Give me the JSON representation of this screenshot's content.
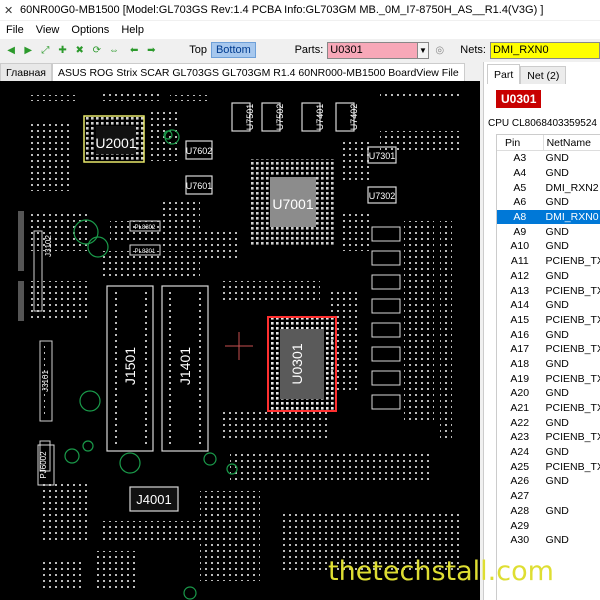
{
  "window": {
    "title": "60NR00G0-MB1500 [Model:GL703GS  Rev:1.4 PCBA Info:GL703GM MB._0M_I7-8750H_AS__R1.4(V3G) ]"
  },
  "menu": [
    "File",
    "View",
    "Options",
    "Help"
  ],
  "toolbar": {
    "top_label": "Top",
    "bottom_label": "Bottom",
    "parts_label": "Parts:",
    "parts_value": "U0301",
    "nets_label": "Nets:",
    "nets_value": "DMI_RXN0"
  },
  "tabs": {
    "main": "Главная",
    "file": "ASUS ROG Strix SCAR GL703GS GL703GM R1.4 60NR000-MB1500 BoardView File"
  },
  "right_panel": {
    "tab_part": "Part",
    "tab_net": "Net (2)",
    "part_name": "U0301",
    "part_desc": "CPU CL8068403359524",
    "col_pin": "Pin",
    "col_netname": "NetName",
    "pins": [
      {
        "pin": "A3",
        "net": "GND"
      },
      {
        "pin": "A4",
        "net": "GND"
      },
      {
        "pin": "A5",
        "net": "DMI_RXN2"
      },
      {
        "pin": "A6",
        "net": "GND"
      },
      {
        "pin": "A8",
        "net": "DMI_RXN0",
        "selected": true
      },
      {
        "pin": "A9",
        "net": "GND"
      },
      {
        "pin": "A10",
        "net": "GND"
      },
      {
        "pin": "A11",
        "net": "PCIENB_TXP"
      },
      {
        "pin": "A12",
        "net": "GND"
      },
      {
        "pin": "A13",
        "net": "PCIENB_TXP"
      },
      {
        "pin": "A14",
        "net": "GND"
      },
      {
        "pin": "A15",
        "net": "PCIENB_TXP"
      },
      {
        "pin": "A16",
        "net": "GND"
      },
      {
        "pin": "A17",
        "net": "PCIENB_TXP"
      },
      {
        "pin": "A18",
        "net": "GND"
      },
      {
        "pin": "A19",
        "net": "PCIENB_TXN"
      },
      {
        "pin": "A20",
        "net": "GND"
      },
      {
        "pin": "A21",
        "net": "PCIENB_TXN"
      },
      {
        "pin": "A22",
        "net": "GND"
      },
      {
        "pin": "A23",
        "net": "PCIENB_TXN"
      },
      {
        "pin": "A24",
        "net": "GND"
      },
      {
        "pin": "A25",
        "net": "PCIENB_TXN"
      },
      {
        "pin": "A26",
        "net": "GND"
      },
      {
        "pin": "A27",
        "net": ""
      },
      {
        "pin": "A28",
        "net": "GND"
      },
      {
        "pin": "A29",
        "net": ""
      },
      {
        "pin": "A30",
        "net": "GND"
      }
    ]
  },
  "board": {
    "labels": {
      "u2001": "U2001",
      "u7001": "U7001",
      "u0301": "U0301",
      "j1501": "J1501",
      "j1401": "J1401",
      "j4001": "J4001",
      "u7501": "U7501",
      "u7502": "U7502",
      "u7401": "U7401",
      "u7402": "U7402",
      "u7602": "U7602",
      "u7601": "U7601",
      "u7301": "U7301",
      "u7302": "U7302",
      "j3102": "J3102",
      "j3101": "J3101",
      "pj6002": "PJ6002",
      "pl8302": "PL8302",
      "pl8301": "PL8301"
    },
    "colors": {
      "background": "#000000",
      "component": "#d8d8d8",
      "highlight_cpu": "#ff3030",
      "highlight_u2001": "#e8e86a",
      "circle": "#1a9a4a"
    }
  },
  "watermark": "thetechstall.com"
}
